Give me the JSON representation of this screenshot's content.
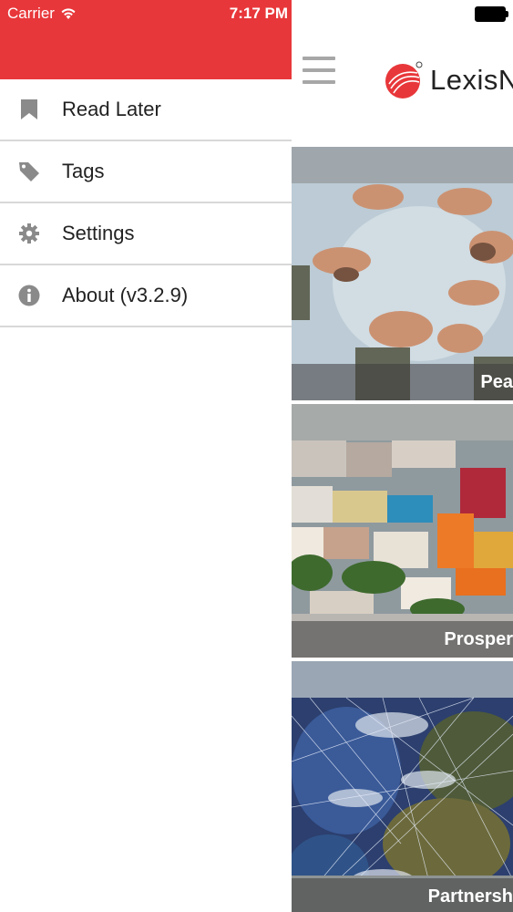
{
  "status_bar": {
    "carrier": "Carrier",
    "time": "7:17 PM"
  },
  "drawer": {
    "header_color": "#e8373a",
    "items": [
      {
        "label": "Read Later",
        "icon": "bookmark-icon"
      },
      {
        "label": "Tags",
        "icon": "tag-icon"
      },
      {
        "label": "Settings",
        "icon": "gear-icon"
      },
      {
        "label": "About (v3.2.9)",
        "icon": "info-icon"
      }
    ]
  },
  "main": {
    "logo_text": "LexisN",
    "cards": [
      {
        "title": "Pea"
      },
      {
        "title": "Prosper"
      },
      {
        "title": "Partnersh"
      }
    ]
  }
}
